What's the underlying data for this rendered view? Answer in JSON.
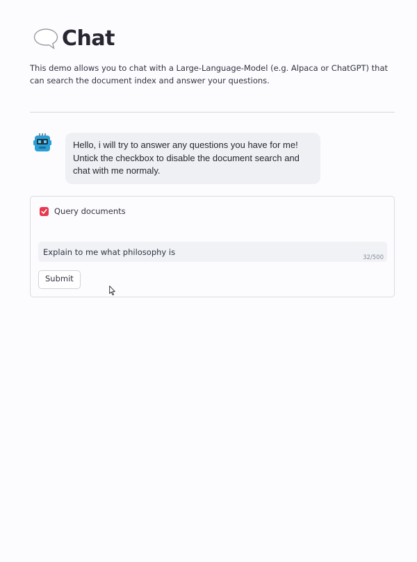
{
  "header": {
    "icon": "speech-balloon-icon",
    "title": "Chat"
  },
  "intro": {
    "text": "This demo allows you to chat with a Large-Language-Model (e.g. Alpaca or ChatGPT) that can search the document index and answer your questions."
  },
  "chat": {
    "messages": [
      {
        "role": "assistant",
        "avatar": "robot-icon",
        "text": "Hello, i will try to answer any questions you have for me! Untick the checkbox to disable the document search and chat with me normaly."
      }
    ]
  },
  "form": {
    "checkbox": {
      "label": "Query documents",
      "checked": true
    },
    "text_area": {
      "value": "Explain to me what philosophy is",
      "char_count": "32/500"
    },
    "submit_label": "Submit"
  },
  "colors": {
    "accent": "#e8384f",
    "bubble_bg": "#eef0f4",
    "input_bg": "#f0f2f6",
    "text": "#31333f"
  }
}
